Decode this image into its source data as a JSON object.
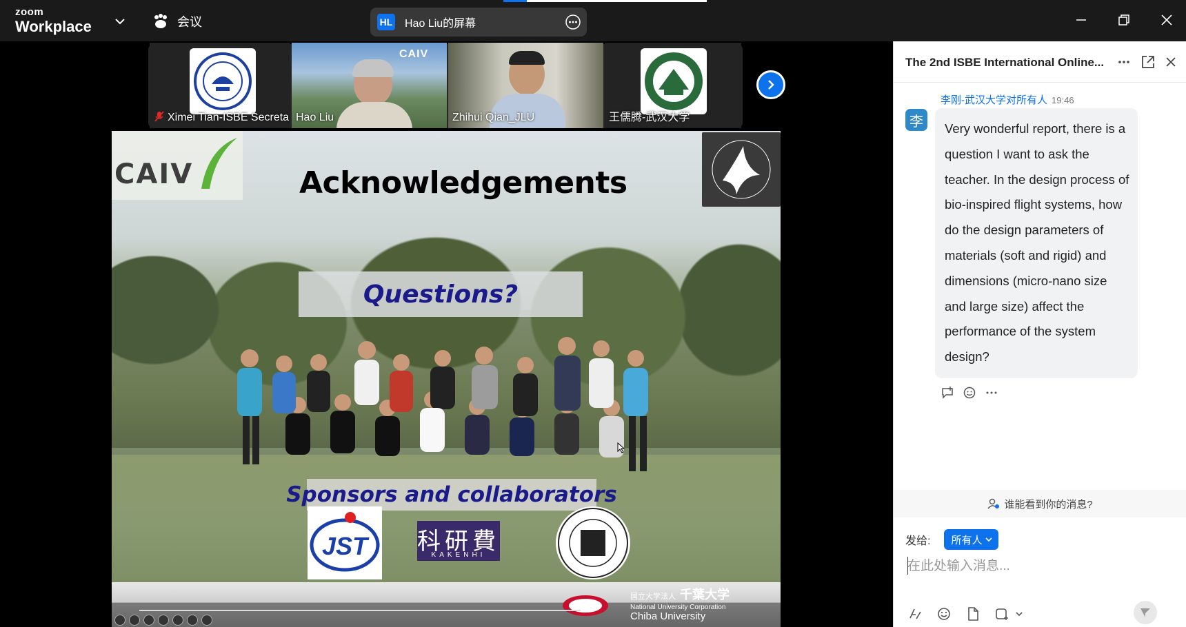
{
  "app": {
    "logo_line1": "zoom",
    "logo_line2": "Workplace",
    "meeting_menu_label": "会议",
    "share_badge": "HL",
    "share_title": "Hao Liu的屏幕"
  },
  "thumbnails": [
    {
      "name": "Ximei Tian-ISBE Secretary",
      "muted": true,
      "active": false
    },
    {
      "name": "Hao Liu",
      "muted": false,
      "active": true
    },
    {
      "name": "Zhihui Qian_JLU",
      "muted": false,
      "active": false
    },
    {
      "name": "王儒腾-武汉大学",
      "muted": false,
      "active": false
    }
  ],
  "slide": {
    "title": "Acknowledgements",
    "questions": "Questions?",
    "sponsors": "Sponsors and collaborators",
    "logo_caiv": "CAIV",
    "logo_jst": "JST",
    "logo_kakenhi_kanji": "科研費",
    "logo_kakenhi_roman": "KAKENHI",
    "footer_corp_jp": "国立大学法人",
    "footer_univ_jp": "千葉大学",
    "footer_corp_en": "National University Corporation",
    "footer_univ_en": "Chiba University"
  },
  "chat": {
    "title": "The 2nd ISBE International Online...",
    "message": {
      "sender": "李刚-武汉大学",
      "to": "对所有人",
      "time": "19:46",
      "avatar_char": "李",
      "text": "Very wonderful report, there is a question I want to ask the teacher. In the design process of bio-inspired flight systems, how do the design parameters of materials (soft and rigid) and dimensions (micro-nano size and large size) affect the performance of the system design?"
    },
    "who_can_see": "谁能看到你的消息?",
    "send_to_label": "发给:",
    "send_to_value": "所有人",
    "input_placeholder": "在此处输入消息..."
  },
  "colors": {
    "accent": "#0e72ed",
    "active_video": "#23d959",
    "titlebar": "#1a1a1a"
  }
}
